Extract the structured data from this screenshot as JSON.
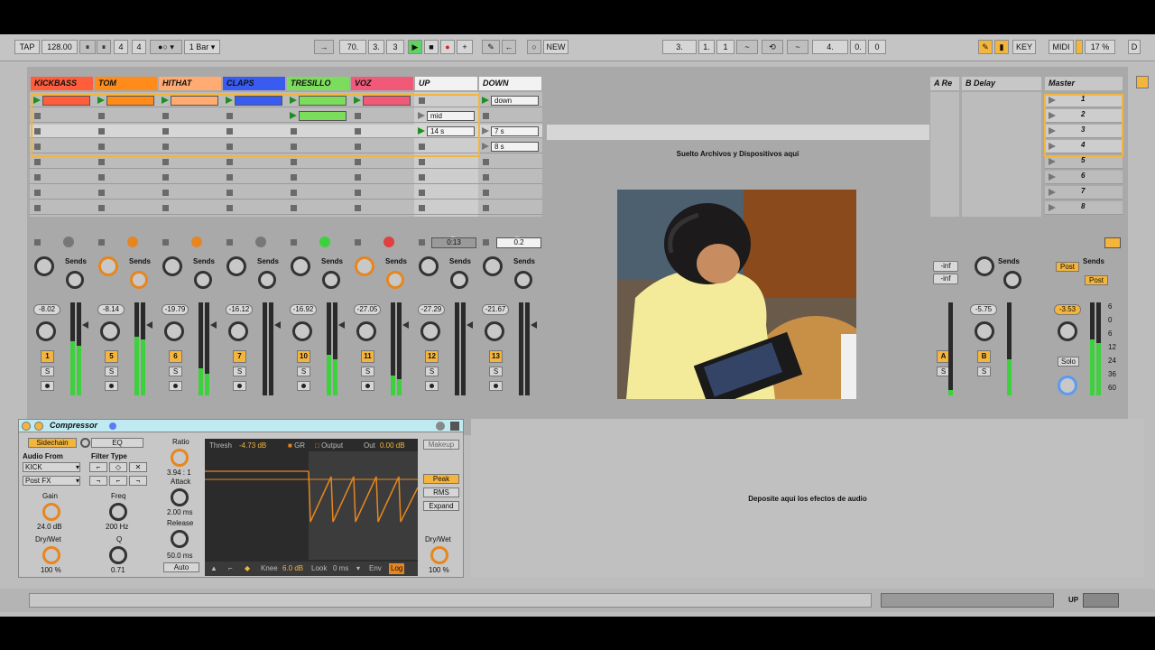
{
  "toolbar": {
    "tap": "TAP",
    "tempo": "128.00",
    "sig_num": "4",
    "sig_den": "4",
    "quant": "1 Bar",
    "arr_pos": [
      "70.",
      "3.",
      "3"
    ],
    "new": "NEW",
    "loop_start": [
      "3.",
      "1.",
      "1"
    ],
    "loop_len": [
      "4.",
      "0.",
      "0"
    ],
    "key": "KEY",
    "midi": "MIDI",
    "cpu": "17 %",
    "d": "D"
  },
  "tracks": [
    {
      "name": "KICKBASS",
      "color": "#ff5d3c",
      "vol": "-8.02",
      "num": "1",
      "clips": [
        "clip",
        "stop",
        "stop",
        "stop",
        "stop",
        "stop",
        "stop",
        "stop"
      ]
    },
    {
      "name": "TOM",
      "color": "#ff8c1a",
      "vol": "-8.14",
      "num": "5",
      "clips": [
        "clip",
        "stop",
        "stop",
        "stop",
        "stop",
        "stop",
        "stop",
        "stop"
      ]
    },
    {
      "name": "HITHAT",
      "color": "#ffab72",
      "vol": "-19.79",
      "num": "6",
      "clips": [
        "clip",
        "stop",
        "stop",
        "stop",
        "stop",
        "stop",
        "stop",
        "stop"
      ]
    },
    {
      "name": "CLAPS",
      "color": "#3a5bf0",
      "vol": "-16.12",
      "num": "7",
      "clips": [
        "clip",
        "stop",
        "stop",
        "stop",
        "stop",
        "stop",
        "stop",
        "stop"
      ]
    },
    {
      "name": "TRESILLO",
      "color": "#7cdc5c",
      "vol": "-16.92",
      "num": "10",
      "clips": [
        "clip",
        "clip",
        "stop",
        "stop",
        "stop",
        "stop",
        "stop",
        "stop"
      ]
    },
    {
      "name": "VOZ",
      "color": "#f05a78",
      "vol": "-27.05",
      "num": "11",
      "clips": [
        "clip",
        "stop",
        "stop",
        "stop",
        "stop",
        "stop",
        "stop",
        "stop"
      ]
    },
    {
      "name": "UP",
      "color": "#f2f2f2",
      "vol": "-27.29",
      "num": "12",
      "clips": [
        "stop",
        "mid",
        "14 s",
        "stop",
        "stop",
        "stop",
        "stop",
        "stop"
      ]
    },
    {
      "name": "DOWN",
      "color": "#f2f2f2",
      "vol": "-21.67",
      "num": "13",
      "clips": [
        "down",
        "stop",
        "7 s",
        "8 s",
        "stop",
        "stop",
        "stop",
        "stop"
      ]
    }
  ],
  "returns": [
    {
      "name": "A Re",
      "letter": "A",
      "inf1": "-inf",
      "inf2": "-inf"
    },
    {
      "name": "B Delay",
      "letter": "B",
      "vol": "-5.75"
    }
  ],
  "master": {
    "name": "Master",
    "scenes": [
      "1",
      "2",
      "3",
      "4",
      "5",
      "6",
      "7",
      "8"
    ],
    "vol": "-3.53",
    "post": "Post",
    "solo": "Solo",
    "db": [
      "6",
      "0",
      "6",
      "12",
      "24",
      "36",
      "60"
    ]
  },
  "session": {
    "drop_files": "Suelto Archivos y Dispositivos aquí",
    "sends": "Sends",
    "up_time": "0:13",
    "down_time": "0.2",
    "s": "S"
  },
  "device": {
    "title": "Compressor",
    "sidechain": "Sidechain",
    "eq": "EQ",
    "audio_from": "Audio From",
    "af_val": "KICK",
    "post_fx": "Post FX",
    "filter_type": "Filter Type",
    "gain": "Gain",
    "gain_val": "24.0 dB",
    "freq": "Freq",
    "freq_val": "200 Hz",
    "drywet": "Dry/Wet",
    "drywet_val": "100 %",
    "q": "Q",
    "q_val": "0.71",
    "ratio": "Ratio",
    "ratio_val": "3.94 : 1",
    "attack": "Attack",
    "attack_val": "2.00 ms",
    "release": "Release",
    "release_val": "50.0 ms",
    "auto": "Auto",
    "thresh": "Thresh",
    "thresh_val": "-4.73 dB",
    "gr": "GR",
    "output": "Output",
    "out": "Out",
    "out_val": "0.00 dB",
    "makeup": "Makeup",
    "peak": "Peak",
    "rms": "RMS",
    "expand": "Expand",
    "dw2": "Dry/Wet",
    "dw2_val": "100 %",
    "knee": "Knee",
    "knee_val": "6.0 dB",
    "look": "Look",
    "look_val": "0 ms",
    "env": "Env",
    "log": "Log"
  },
  "drop_effects": "Deposite aquí los efectos de audio",
  "bottom": {
    "up": "UP"
  }
}
